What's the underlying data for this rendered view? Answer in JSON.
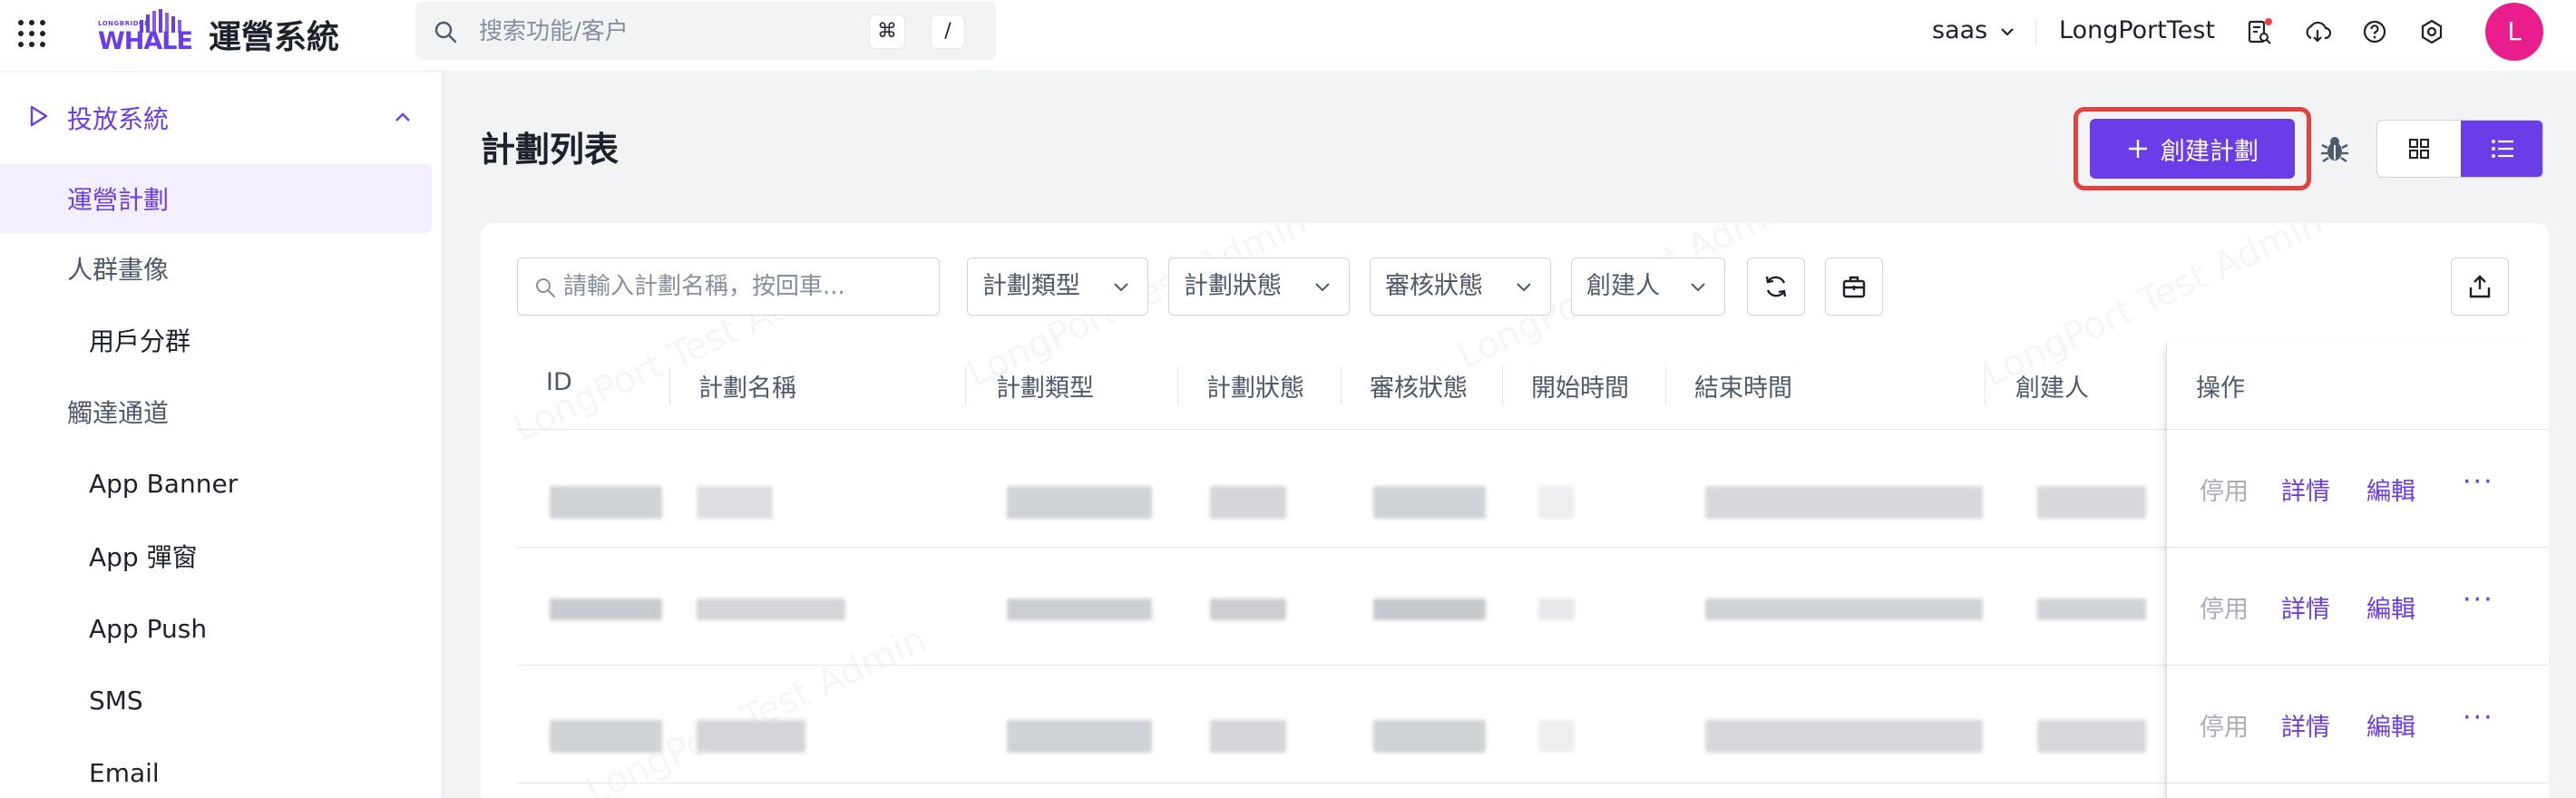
{
  "header": {
    "logo_small": "LONGBRIDGE",
    "logo_main": "WHALE",
    "system_title": "運營系統",
    "search_placeholder": "搜索功能/客户",
    "shortcut_cmd": "⌘",
    "shortcut_slash": "/",
    "tenant": "saas",
    "account": "LongPortTest",
    "avatar_initial": "L",
    "icons": [
      "file-search-icon",
      "download-icon",
      "help-icon",
      "settings-icon"
    ]
  },
  "sidebar": {
    "section_label": "投放系統",
    "items": [
      {
        "label": "運營計劃",
        "active": true
      },
      {
        "label": "人群畫像",
        "group": true
      },
      {
        "label": "用戶分群"
      },
      {
        "label": "觸達通道",
        "group": true
      },
      {
        "label": "App Banner"
      },
      {
        "label": "App 彈窗"
      },
      {
        "label": "App Push"
      },
      {
        "label": "SMS"
      },
      {
        "label": "Email"
      }
    ]
  },
  "main": {
    "page_title": "計劃列表",
    "create_button": "創建計劃",
    "filters": {
      "search_placeholder": "請輸入計劃名稱，按回車...",
      "plan_type": "計劃類型",
      "plan_status": "計劃狀態",
      "review_status": "審核狀態",
      "creator": "創建人"
    },
    "table": {
      "columns": [
        "ID",
        "計劃名稱",
        "計劃類型",
        "計劃狀態",
        "審核狀態",
        "開始時間",
        "結束時間",
        "創建人",
        "操作"
      ],
      "rows": [
        {
          "disable": "停用",
          "detail": "詳情",
          "edit": "編輯",
          "more": "···"
        },
        {
          "disable": "停用",
          "detail": "詳情",
          "edit": "編輯",
          "more": "···"
        },
        {
          "disable": "停用",
          "detail": "詳情",
          "edit": "編輯",
          "more": "···"
        }
      ]
    },
    "watermark": "LongPort Test Admin"
  },
  "colors": {
    "accent": "#6a3de8",
    "highlight": "#e3413c",
    "avatar": "#e91e8c"
  }
}
